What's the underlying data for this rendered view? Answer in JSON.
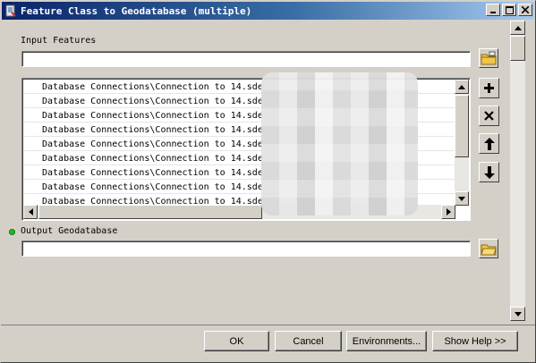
{
  "window": {
    "title": "Feature Class to Geodatabase (multiple)",
    "controls": [
      "minimize-icon",
      "maximize-icon",
      "close-icon"
    ]
  },
  "input_features": {
    "label": "Input Features",
    "value": "",
    "rows": [
      "Database Connections\\Connection to 14.sde",
      "Database Connections\\Connection to 14.sde",
      "Database Connections\\Connection to 14.sde",
      "Database Connections\\Connection to 14.sde",
      "Database Connections\\Connection to 14.sde",
      "Database Connections\\Connection to 14.sde",
      "Database Connections\\Connection to 14.sde",
      "Database Connections\\Connection to 14.sde",
      "Database Connections\\Connection to 14.sde"
    ],
    "side_buttons": [
      "add-icon",
      "remove-icon",
      "move-up-icon",
      "move-down-icon"
    ]
  },
  "output_geodatabase": {
    "label": "Output Geodatabase",
    "value": ""
  },
  "buttons": {
    "ok": "OK",
    "cancel": "Cancel",
    "environments": "Environments...",
    "show_help": "Show Help >>"
  },
  "colors": {
    "title_bar_start": "#0a246a",
    "title_bar_end": "#a6caf0",
    "dialog_face": "#d4d0c8",
    "required_indicator": "#22bb22"
  }
}
